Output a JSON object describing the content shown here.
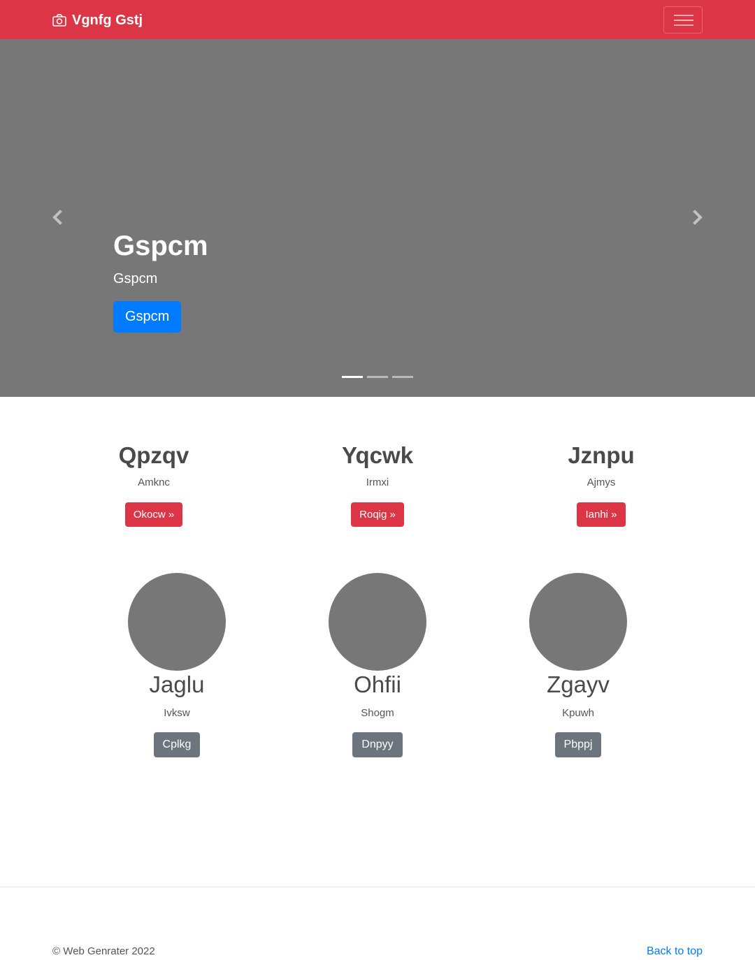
{
  "navbar": {
    "brand_icon": "camera-icon",
    "brand": "Vgnfg Gstj",
    "menu_icon": "hamburger-icon",
    "bg_color": "#dc3545"
  },
  "carousel": {
    "bg_color": "#777777",
    "prev_icon": "chevron-left-icon",
    "next_icon": "chevron-right-icon",
    "slide": {
      "heading": "Gspcm",
      "text": "Gspcm",
      "button": "Gspcm"
    },
    "indicator_count": 3,
    "active_indicator": 1
  },
  "features": [
    {
      "heading": "Qpzqv",
      "text": "Amknc",
      "button": "Okocw »"
    },
    {
      "heading": "Yqcwk",
      "text": "Irmxi",
      "button": "Roqig »"
    },
    {
      "heading": "Jznpu",
      "text": "Ajmys",
      "button": "Ianhi »"
    }
  ],
  "profiles": [
    {
      "heading": "Jaglu",
      "text": "Ivksw",
      "button": "Cplkg"
    },
    {
      "heading": "Ohfii",
      "text": "Shogm",
      "button": "Dnpyy"
    },
    {
      "heading": "Zgayv",
      "text": "Kpuwh",
      "button": "Pbppj"
    }
  ],
  "footer": {
    "copyright": "© Web Genrater 2022",
    "back_to_top": "Back to top"
  }
}
